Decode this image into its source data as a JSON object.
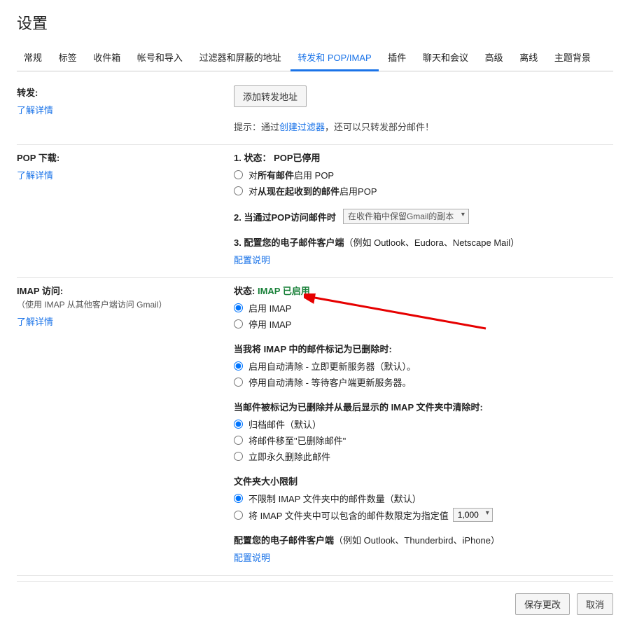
{
  "page_title": "设置",
  "tabs": {
    "general": "常规",
    "labels": "标签",
    "inbox": "收件箱",
    "accounts": "帐号和导入",
    "filters": "过滤器和屏蔽的地址",
    "forwarding": "转发和 POP/IMAP",
    "addons": "插件",
    "chat": "聊天和会议",
    "advanced": "高级",
    "offline": "离线",
    "themes": "主题背景"
  },
  "forward": {
    "title": "转发:",
    "learn_more": "了解详情",
    "add_address_btn": "添加转发地址",
    "hint_prefix": "提示：通过",
    "hint_link": "创建过滤器",
    "hint_suffix": "，还可以只转发部分邮件！"
  },
  "pop": {
    "title": "POP 下载:",
    "learn_more": "了解详情",
    "status_title": "1. 状态：",
    "status_value": "POP已停用",
    "radio_all_prefix": "对",
    "radio_all_bold": "所有邮件",
    "radio_all_suffix": "启用 POP",
    "radio_now_prefix": "对",
    "radio_now_bold": "从现在起收到的邮件",
    "radio_now_suffix": "启用POP",
    "access_prefix": "2. ",
    "access_title": "当通过POP访问邮件时",
    "access_select": "在收件箱中保留Gmail的副本",
    "configure_title": "3. 配置您的电子邮件客户端",
    "configure_examples": "（例如 Outlook、Eudora、Netscape Mail）",
    "configure_link": "配置说明"
  },
  "imap": {
    "title": "IMAP 访问:",
    "subtitle": "（使用 IMAP 从其他客户端访问 Gmail）",
    "learn_more": "了解详情",
    "status_label": "状态:",
    "status_value": "IMAP 已启用",
    "radio_enable": "启用 IMAP",
    "radio_disable": "停用 IMAP",
    "delete_mark_title": "当我将 IMAP 中的邮件标记为已删除时:",
    "delete_mark_opt1": "启用自动清除 - 立即更新服务器（默认）。",
    "delete_mark_opt2": "停用自动清除 - 等待客户端更新服务器。",
    "last_folder_title": "当邮件被标记为已删除并从最后显示的 IMAP 文件夹中清除时:",
    "last_folder_opt1": "归档邮件（默认）",
    "last_folder_opt2": "将邮件移至\"已删除邮件\"",
    "last_folder_opt3": "立即永久删除此邮件",
    "folder_limit_title": "文件夹大小限制",
    "folder_limit_opt1": "不限制 IMAP 文件夹中的邮件数量（默认）",
    "folder_limit_opt2": "将 IMAP 文件夹中可以包含的邮件数限定为指定值",
    "folder_limit_value": "1,000",
    "configure_title": "配置您的电子邮件客户端",
    "configure_examples": "（例如 Outlook、Thunderbird、iPhone）",
    "configure_link": "配置说明"
  },
  "footer": {
    "save": "保存更改",
    "cancel": "取消"
  }
}
